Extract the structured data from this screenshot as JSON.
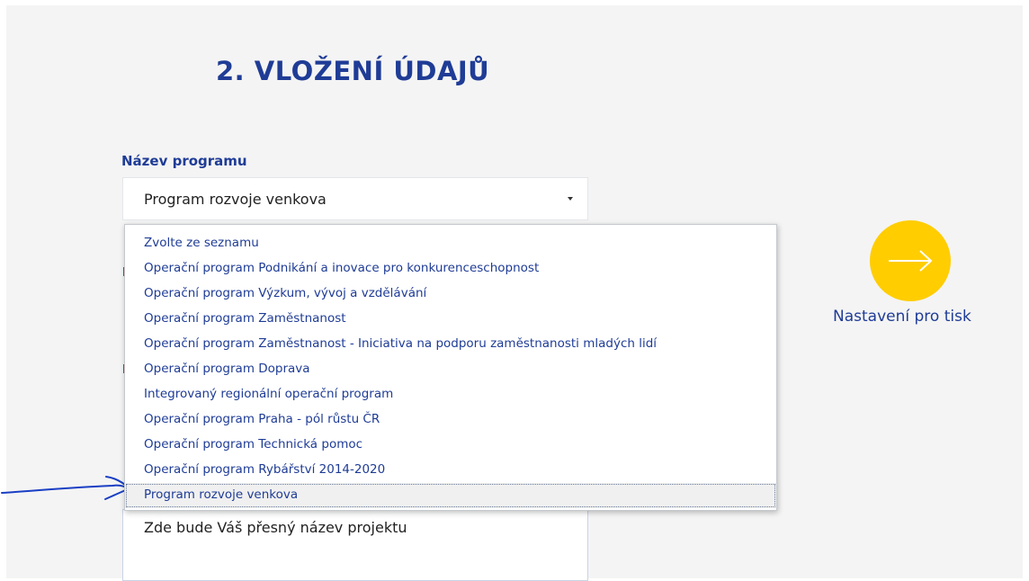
{
  "step": {
    "title": "2. VLOŽENÍ ÚDAJŮ"
  },
  "program_field": {
    "label": "Název programu",
    "value": "Program rozvoje venkova",
    "options": [
      "Zvolte ze seznamu",
      "Operační program Podnikání a inovace pro konkurenceschopnost",
      "Operační program Výzkum, vývoj a vzdělávání",
      "Operační program Zaměstnanost",
      "Operační program Zaměstnanost - Iniciativa na podporu zaměstnanosti mladých lidí",
      "Operační program Doprava",
      "Integrovaný regionální operační program",
      "Operační program Praha - pól růstu ČR",
      "Operační program Technická pomoc",
      "Operační program Rybářství 2014-2020",
      "Program rozvoje venkova"
    ],
    "selected_index": 10
  },
  "project_name": {
    "value": "Zde bude Váš přesný název projektu"
  },
  "print_settings": {
    "label": "Nastavení pro tisk",
    "icon": "arrow-right-icon"
  },
  "colors": {
    "accent": "#1f3c96",
    "button": "#ffcd00",
    "annotation": "#1a3fc4"
  }
}
